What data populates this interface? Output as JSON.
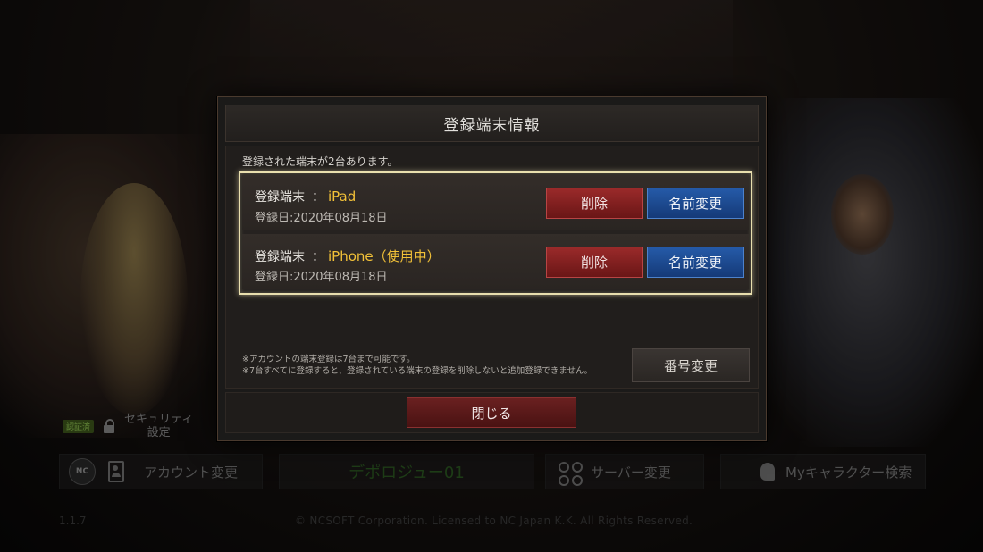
{
  "dialog": {
    "title": "登録端末情報",
    "device_count_text": "登録された端末が2台あります。",
    "devices": [
      {
        "label": "登録端末",
        "colon": "：",
        "model": "iPad",
        "date": "登録日:2020年08月18日",
        "delete_label": "削除",
        "rename_label": "名前変更"
      },
      {
        "label": "登録端末",
        "colon": "：",
        "model": "iPhone（使用中）",
        "date": "登録日:2020年08月18日",
        "delete_label": "削除",
        "rename_label": "名前変更"
      }
    ],
    "notes": [
      "※アカウントの端末登録は7台まで可能です。",
      "※7台すべてに登録すると、登録されている端末の登録を削除しないと追加登録できません。"
    ],
    "number_change_label": "番号変更",
    "close_label": "閉じる"
  },
  "launcher": {
    "security_badge": "認証済",
    "security_label_line1": "セキュリティ",
    "security_label_line2": "設定",
    "nc_logo_text": "NC",
    "account_change_label": "アカウント変更",
    "server_name": "デポロジュー01",
    "server_change_label": "サーバー変更",
    "my_character_label": "Myキャラクター検索",
    "version": "1.1.7",
    "copyright": "© NCSOFT Corporation. Licensed to NC Japan K.K. All Rights Reserved."
  },
  "colors": {
    "model_highlight": "#f2c138",
    "delete_button": "#8a2222",
    "rename_button": "#1f4d94",
    "list_border": "#e9dfae"
  },
  "icons": [
    "lock-icon",
    "nc-logo-icon",
    "person-card-icon",
    "server-grid-icon",
    "helmet-icon"
  ]
}
